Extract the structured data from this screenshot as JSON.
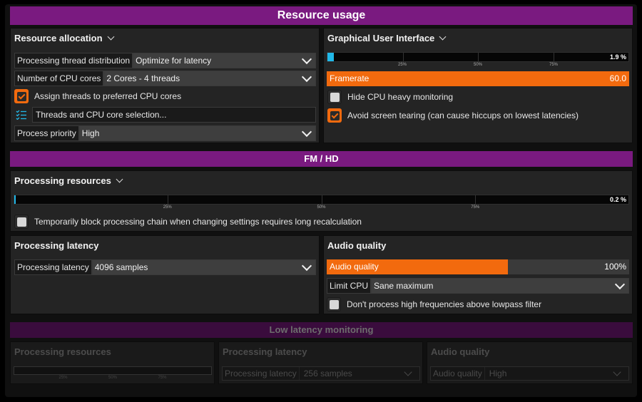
{
  "window": {
    "title": "Resource usage"
  },
  "resource_allocation": {
    "title": "Resource allocation",
    "thread_distribution": {
      "label": "Processing thread distribution",
      "value": "Optimize for latency"
    },
    "cpu_cores": {
      "label": "Number of CPU cores",
      "value": "2 Cores - 4 threads"
    },
    "assign_threads": {
      "label": "Assign threads to preferred CPU cores",
      "checked": true
    },
    "threads_selection": {
      "label": "Threads and CPU core selection...",
      "icon": "list-check-icon"
    },
    "process_priority": {
      "label": "Process priority",
      "value": "High"
    }
  },
  "gui": {
    "title": "Graphical User Interface",
    "cpu_meter": {
      "value_text": "1.9 %",
      "fraction": 0.019,
      "ticks": [
        "25%",
        "50%",
        "75%"
      ]
    },
    "framerate": {
      "label": "Framerate",
      "value": "60.0",
      "fraction": 1.0
    },
    "hide_cpu": {
      "label": "Hide CPU heavy monitoring",
      "checked": false
    },
    "avoid_tearing": {
      "label": "Avoid screen tearing (can cause hiccups on lowest latencies)",
      "checked": true
    }
  },
  "fm_hd": {
    "banner": "FM / HD",
    "processing_resources": {
      "title": "Processing resources",
      "meter": {
        "value_text": "0.2 %",
        "fraction": 0.002,
        "ticks": [
          "25%",
          "50%",
          "75%"
        ]
      },
      "block_chain": {
        "label": "Temporarily block processing chain when changing settings requires long recalculation",
        "checked": false
      }
    },
    "processing_latency": {
      "title": "Processing latency",
      "field": {
        "label": "Processing latency",
        "value": "4096 samples"
      }
    },
    "audio_quality": {
      "title": "Audio quality",
      "bar": {
        "label": "Audio quality",
        "value": "100%",
        "fraction": 0.6
      },
      "limit_cpu": {
        "label": "Limit CPU",
        "value": "Sane maximum"
      },
      "lowpass": {
        "label": "Don't process high frequencies above lowpass filter",
        "checked": false
      }
    }
  },
  "low_latency": {
    "banner": "Low latency monitoring",
    "processing_resources": {
      "title": "Processing resources",
      "ticks": [
        "25%",
        "50%",
        "75%"
      ]
    },
    "processing_latency": {
      "title": "Processing latency",
      "label": "Processing latency",
      "value": "256 samples"
    },
    "audio_quality": {
      "title": "Audio quality",
      "label": "Audio quality",
      "value": "High"
    }
  },
  "colors": {
    "accent": "#f26a0e",
    "banner": "#7a1a80",
    "meter": "#21b8e8"
  }
}
